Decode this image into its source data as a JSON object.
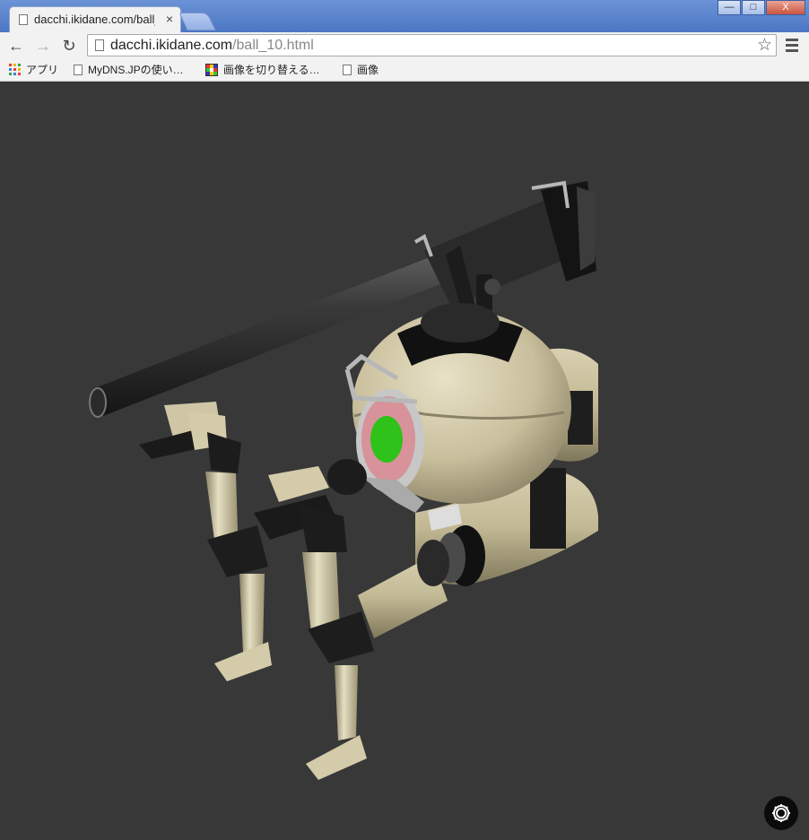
{
  "browser": {
    "tab": {
      "title": "dacchi.ikidane.com/ball_",
      "close": "×"
    },
    "window_buttons": {
      "minimize": "—",
      "restore": "□",
      "close": "X"
    },
    "nav": {
      "back": "←",
      "forward": "→",
      "reload": "↻"
    },
    "address": {
      "host": "dacchi.ikidane.com",
      "path": "/ball_10.html"
    },
    "star": "☆"
  },
  "bookmarks": [
    {
      "label": "アプリ",
      "icon": "apps-grid-icon"
    },
    {
      "label": "MyDNS.JPの使い…",
      "icon": "page-icon"
    },
    {
      "label": "画像を切り替える…",
      "icon": "color-grid-icon"
    },
    {
      "label": "画像",
      "icon": "page-icon"
    }
  ],
  "scene": {
    "description_icon": "3d-robot-ball-mech",
    "colors": {
      "background": "#383838",
      "body": "#cfc6a6",
      "dark": "#1a1a1a",
      "eye_ring": "#d88a94",
      "eye": "#2ec21a",
      "metal": "#b8b8b8"
    }
  },
  "settings_button": {
    "icon": "gear-icon"
  }
}
